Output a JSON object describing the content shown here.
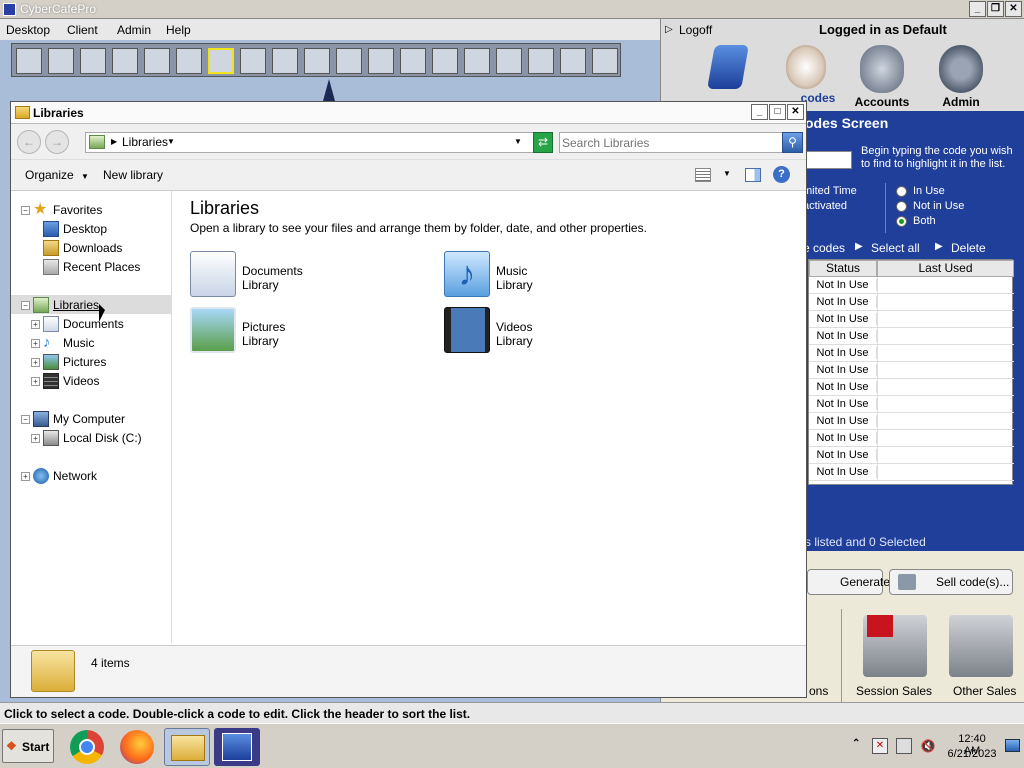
{
  "app": {
    "title": "CyberCafePro",
    "menu": [
      "Desktop",
      "Client",
      "Admin",
      "Help"
    ],
    "colors": {
      "accent": "#1f3f9a",
      "selection": "#f3e31c"
    }
  },
  "right_panel": {
    "logoff": "Logoff",
    "logged_in": "Logged in as Default",
    "nav": [
      {
        "label": "",
        "icon": "computer-icon"
      },
      {
        "label": "codes",
        "icon": "stopwatch-icon"
      },
      {
        "label": "Accounts",
        "icon": "accounts-icon"
      },
      {
        "label": "Admin",
        "icon": "admin-gears-icon"
      }
    ],
    "screen_title": "odes Screen",
    "hint": "Begin typing the code you wish to find to highlight it in the list.",
    "left_labels": [
      "mited Time",
      "activated"
    ],
    "radios": [
      "In Use",
      "Not in Use",
      "Both"
    ],
    "radio_selected": "Both",
    "actions": [
      "e codes",
      "Select all",
      "Delete"
    ],
    "table": {
      "headers": [
        "Status",
        "Last Used"
      ],
      "rows": [
        "Not In Use",
        "Not In Use",
        "Not In Use",
        "Not In Use",
        "Not In Use",
        "Not In Use",
        "Not In Use",
        "Not In Use",
        "Not In Use",
        "Not In Use",
        "Not In Use",
        "Not In Use"
      ]
    },
    "summary": "s listed and 0 Selected",
    "generate": "Generate...",
    "sell": "Sell code(s)...",
    "bottom": [
      "ons",
      "Session Sales",
      "Other Sales"
    ]
  },
  "explorer": {
    "title": "Libraries",
    "breadcrumb": "Libraries",
    "search_placeholder": "Search Libraries",
    "toolbar": {
      "organize": "Organize",
      "new_library": "New library"
    },
    "nav": {
      "favorites": "Favorites",
      "favorites_items": [
        "Desktop",
        "Downloads",
        "Recent Places"
      ],
      "libraries": "Libraries",
      "libraries_items": [
        "Documents",
        "Music",
        "Pictures",
        "Videos"
      ],
      "computer": "My Computer",
      "computer_items": [
        "Local Disk (C:)"
      ],
      "network": "Network"
    },
    "heading": "Libraries",
    "description": "Open a library to see your files and arrange them by folder, date, and other properties.",
    "libraries": [
      {
        "name": "Documents",
        "sub": "Library",
        "icon": "documents-library-icon"
      },
      {
        "name": "Music",
        "sub": "Library",
        "icon": "music-library-icon"
      },
      {
        "name": "Pictures",
        "sub": "Library",
        "icon": "pictures-library-icon"
      },
      {
        "name": "Videos",
        "sub": "Library",
        "icon": "videos-library-icon"
      }
    ],
    "item_count": "4 items"
  },
  "statusbar": "Click to select a code. Double-click a code to edit. Click the header to sort the list.",
  "taskbar": {
    "start": "Start",
    "time": "12:40 AM",
    "date": "6/21/2023"
  }
}
